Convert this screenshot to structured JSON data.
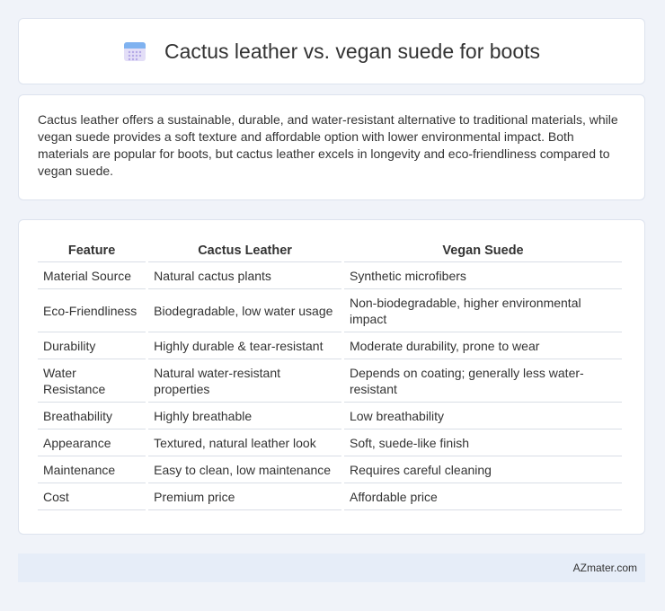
{
  "title": "Cactus leather vs. vegan suede for boots",
  "summary": "Cactus leather offers a sustainable, durable, and water-resistant alternative to traditional materials, while vegan suede provides a soft texture and affordable option with lower environmental impact. Both materials are popular for boots, but cactus leather excels in longevity and eco-friendliness compared to vegan suede.",
  "table": {
    "headers": [
      "Feature",
      "Cactus Leather",
      "Vegan Suede"
    ],
    "rows": [
      [
        "Material Source",
        "Natural cactus plants",
        "Synthetic microfibers"
      ],
      [
        "Eco-Friendliness",
        "Biodegradable, low water usage",
        "Non-biodegradable, higher environmental impact"
      ],
      [
        "Durability",
        "Highly durable & tear-resistant",
        "Moderate durability, prone to wear"
      ],
      [
        "Water Resistance",
        "Natural water-resistant properties",
        "Depends on coating; generally less water-resistant"
      ],
      [
        "Breathability",
        "Highly breathable",
        "Low breathability"
      ],
      [
        "Appearance",
        "Textured, natural leather look",
        "Soft, suede-like finish"
      ],
      [
        "Maintenance",
        "Easy to clean, low maintenance",
        "Requires careful cleaning"
      ],
      [
        "Cost",
        "Premium price",
        "Affordable price"
      ]
    ]
  },
  "footer": "AZmater.com",
  "icon": "calendar-icon",
  "colors": {
    "background": "#f0f3f9",
    "footer_bg": "#e6edf8",
    "icon_top": "#7fb2f0",
    "icon_body": "#d7d2f3"
  }
}
